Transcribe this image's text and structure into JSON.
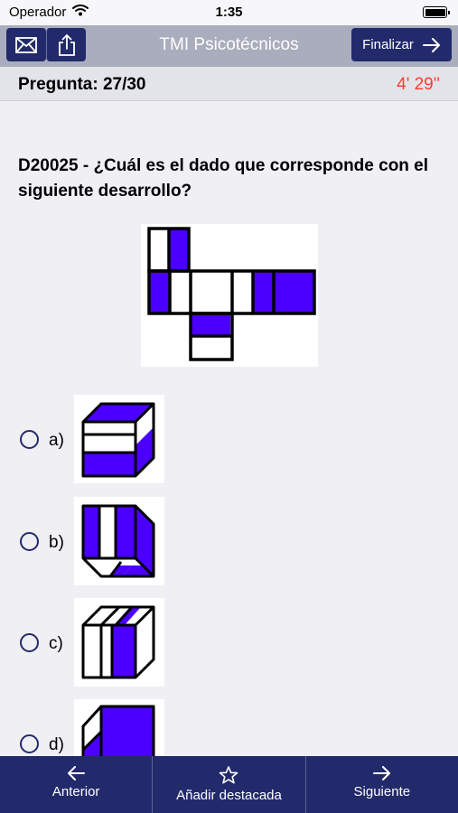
{
  "status": {
    "carrier": "Operador",
    "time": "1:35"
  },
  "nav": {
    "title": "TMI Psicotécnicos",
    "finalize_label": "Finalizar"
  },
  "question": {
    "counter": "Pregunta: 27/30",
    "timer": "4' 29''",
    "text": "D20025 - ¿Cuál es el dado que corresponde con el siguiente desarrollo?"
  },
  "options": [
    {
      "label": "a)"
    },
    {
      "label": "b)"
    },
    {
      "label": "c)"
    },
    {
      "label": "d)"
    }
  ],
  "tabbar": {
    "prev": "Anterior",
    "star": "Añadir destacada",
    "next": "Siguiente"
  },
  "colors": {
    "accent": "#222a6b",
    "face_fill": "#4b00ff",
    "timer": "#ff3b30"
  }
}
